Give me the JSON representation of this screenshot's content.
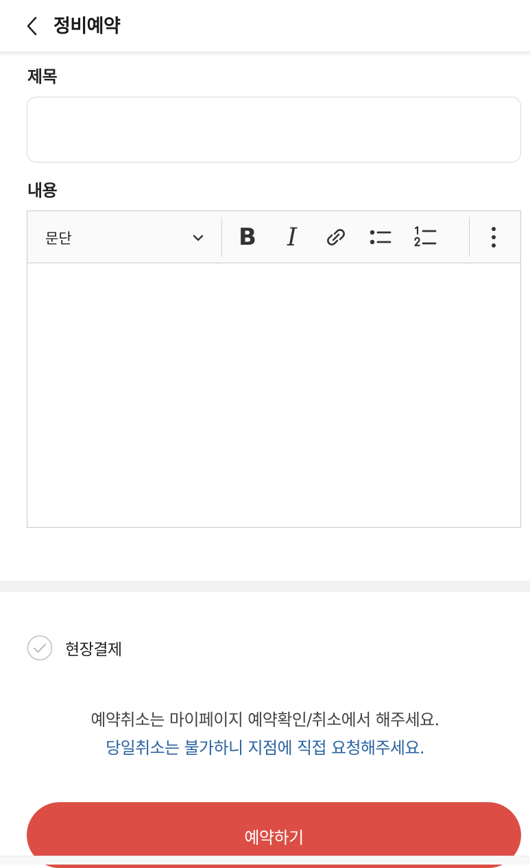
{
  "header": {
    "title": "정비예약",
    "back_icon": "chevron-left-icon"
  },
  "form": {
    "title_label": "제목",
    "title_value": "",
    "title_placeholder": "",
    "content_label": "내용"
  },
  "editor": {
    "paragraph_label": "문단",
    "bold_label": "B",
    "italic_label": "I",
    "icons": [
      "chevron-down-icon",
      "link-icon",
      "bullet-list-icon",
      "numbered-list-icon",
      "more-vertical-icon"
    ]
  },
  "payment": {
    "onsite_label": "현장결제",
    "checked": false
  },
  "notice": {
    "line1": "예약취소는 마이페이지 예약확인/취소에서 해주세요.",
    "line2": "당일취소는 불가하니 지점에 직접 요청해주세요."
  },
  "submit": {
    "label": "예약하기"
  },
  "colors": {
    "accent": "#dc4e45",
    "notice_blue": "#2b62a0",
    "border": "#d8d8d8"
  }
}
